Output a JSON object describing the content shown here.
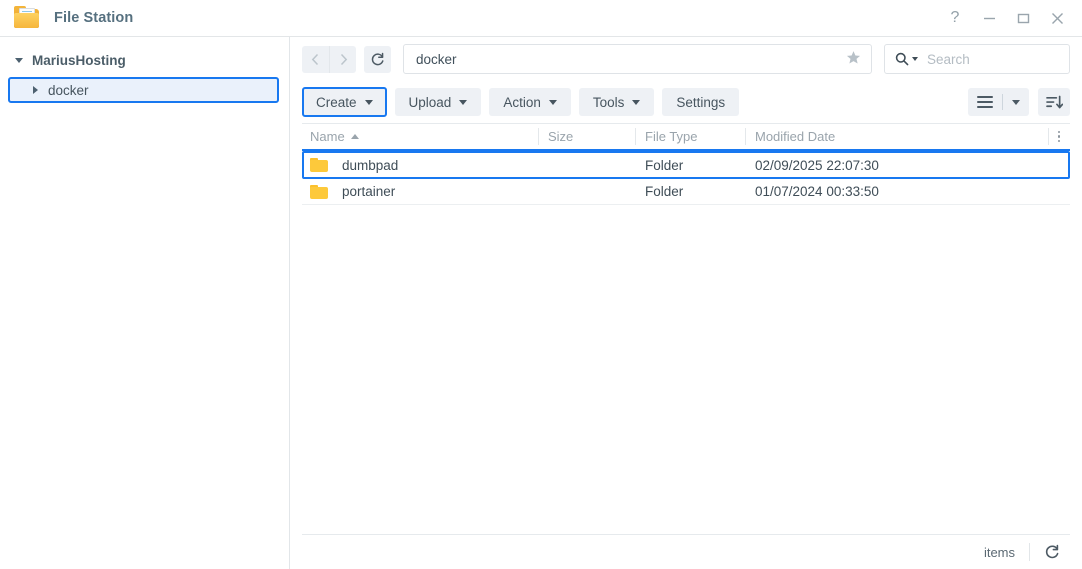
{
  "window": {
    "title": "File Station",
    "app_icon": "folder-icon",
    "controls": [
      {
        "name": "help-button",
        "label": "?"
      },
      {
        "name": "minimize-button",
        "label": "—"
      },
      {
        "name": "maximize-button",
        "label": "▭"
      },
      {
        "name": "close-button",
        "label": "✕"
      }
    ]
  },
  "sidebar": {
    "root": {
      "label": "MariusHosting",
      "expanded": true,
      "caret": "caret-down-icon"
    },
    "children": [
      {
        "label": "docker",
        "expanded": false,
        "caret": "caret-right-icon",
        "selected": true
      }
    ]
  },
  "nav": {
    "back_label": "‹",
    "forward_label": "›",
    "refresh_label": "⟳",
    "path_value": "docker",
    "favorite_icon": "star-icon"
  },
  "search": {
    "placeholder": "Search",
    "icon": "search-icon"
  },
  "toolbar": {
    "buttons": [
      {
        "name": "create-button",
        "label": "Create",
        "has_caret": true,
        "focused": true
      },
      {
        "name": "upload-button",
        "label": "Upload",
        "has_caret": true,
        "focused": false
      },
      {
        "name": "action-button",
        "label": "Action",
        "has_caret": true,
        "focused": false
      },
      {
        "name": "tools-button",
        "label": "Tools",
        "has_caret": true,
        "focused": false
      },
      {
        "name": "settings-button",
        "label": "Settings",
        "has_caret": false,
        "focused": false
      }
    ],
    "view_mode_icon": "list-view-icon",
    "view_mode_caret": "chevron-down-icon",
    "sort_icon": "sort-descending-icon"
  },
  "table": {
    "columns": [
      {
        "key": "name",
        "label": "Name",
        "sorted": "asc"
      },
      {
        "key": "size",
        "label": "Size",
        "sorted": ""
      },
      {
        "key": "type",
        "label": "File Type",
        "sorted": ""
      },
      {
        "key": "date",
        "label": "Modified Date",
        "sorted": ""
      }
    ],
    "column_options_icon": "more-vertical-icon",
    "rows": [
      {
        "icon": "folder-icon",
        "name": "dumbpad",
        "size": "",
        "type": "Folder",
        "date": "02/09/2025 22:07:30",
        "selected": true
      },
      {
        "icon": "folder-icon",
        "name": "portainer",
        "size": "",
        "type": "Folder",
        "date": "01/07/2024 00:33:50",
        "selected": false
      }
    ]
  },
  "statusbar": {
    "items_label": "items",
    "refresh_icon": "refresh-icon"
  },
  "colors": {
    "accent_blue": "#1878f0",
    "folder_yellow": "#fdc93b",
    "text_dark": "#3f4d57",
    "text_muted": "#9aa4ac",
    "button_bg": "#eef1f5"
  }
}
